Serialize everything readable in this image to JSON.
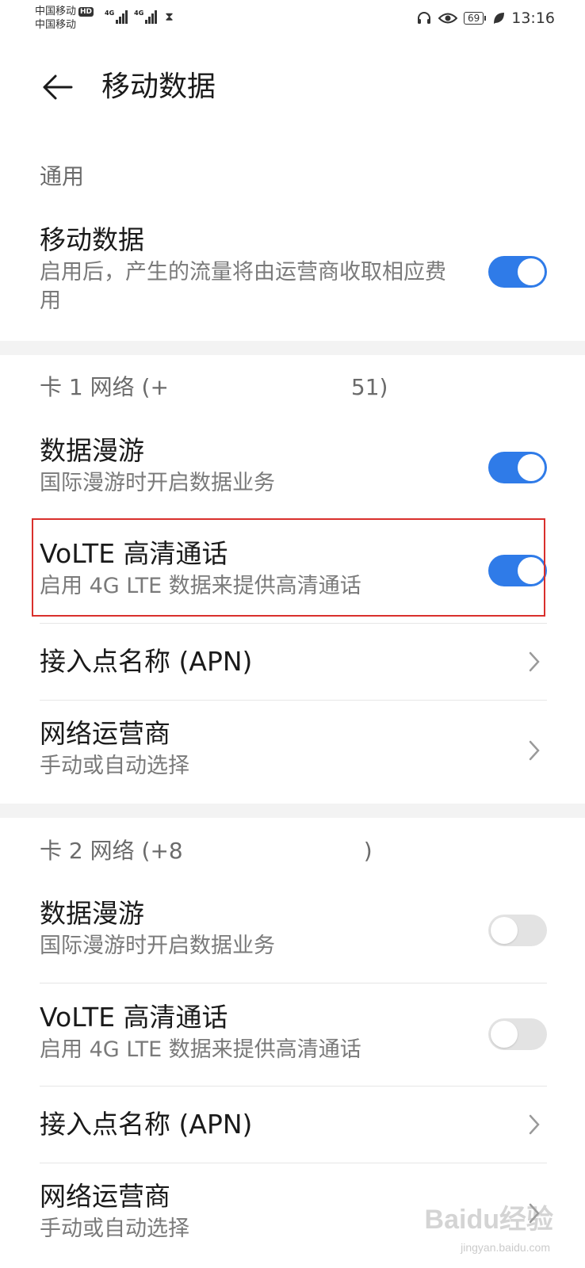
{
  "status_bar": {
    "carrier_1": "中国移动",
    "hd_badge": "HD",
    "carrier_2": "中国移动",
    "signal_1_label": "4G",
    "signal_2_label": "4G",
    "battery": "69",
    "time": "13:16",
    "icons": [
      "headset-icon",
      "eye-icon",
      "battery-icon",
      "leaf-icon"
    ]
  },
  "header": {
    "title": "移动数据",
    "back_icon": "arrow-left-icon"
  },
  "sections": {
    "general": {
      "title": "通用",
      "mobile_data": {
        "title": "移动数据",
        "subtitle": "启用后，产生的流量将由运营商收取相应费用",
        "enabled": true
      }
    },
    "sim1": {
      "title_prefix": "卡 1 网络 (+",
      "title_suffix": "51)",
      "roaming": {
        "title": "数据漫游",
        "subtitle": "国际漫游时开启数据业务",
        "enabled": true
      },
      "volte": {
        "title": "VoLTE 高清通话",
        "subtitle": "启用 4G LTE 数据来提供高清通话",
        "enabled": true
      },
      "apn": {
        "title": "接入点名称 (APN)"
      },
      "operator": {
        "title": "网络运营商",
        "subtitle": "手动或自动选择"
      }
    },
    "sim2": {
      "title_prefix": "卡 2 网络 (+8",
      "title_suffix": ")",
      "roaming": {
        "title": "数据漫游",
        "subtitle": "国际漫游时开启数据业务",
        "enabled": false
      },
      "volte": {
        "title": "VoLTE 高清通话",
        "subtitle": "启用 4G LTE 数据来提供高清通话",
        "enabled": false
      },
      "apn": {
        "title": "接入点名称 (APN)"
      },
      "operator": {
        "title": "网络运营商",
        "subtitle": "手动或自动选择"
      }
    }
  },
  "colors": {
    "toggle_on": "#2f7be8",
    "toggle_off": "#e3e3e3",
    "highlight": "#d9302c"
  },
  "watermark": {
    "text": "Baidu经验",
    "sub": "jingyan.baidu.com"
  }
}
